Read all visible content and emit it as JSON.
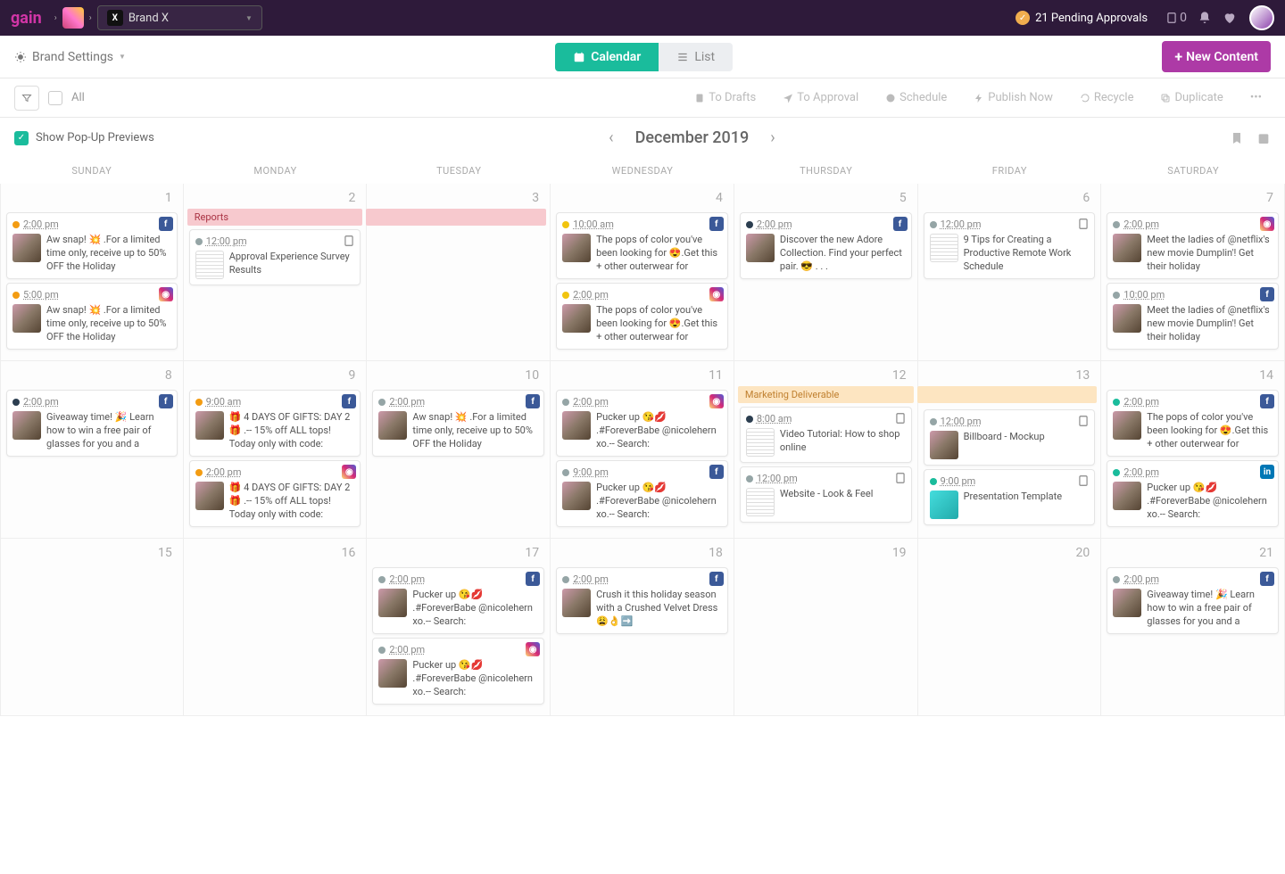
{
  "topbar": {
    "logo": "gain",
    "brand": "Brand X",
    "pending_label": "21 Pending Approvals",
    "notification_count": "0"
  },
  "secondbar": {
    "brand_settings": "Brand Settings",
    "calendar_label": "Calendar",
    "list_label": "List",
    "new_content": "New Content"
  },
  "thirdbar": {
    "all_label": "All",
    "actions": {
      "to_drafts": "To Drafts",
      "to_approval": "To Approval",
      "schedule": "Schedule",
      "publish_now": "Publish Now",
      "recycle": "Recycle",
      "duplicate": "Duplicate"
    }
  },
  "cal_header": {
    "popup_label": "Show Pop-Up Previews",
    "month": "December 2019"
  },
  "days": [
    "SUNDAY",
    "MONDAY",
    "TUESDAY",
    "WEDNESDAY",
    "THURSDAY",
    "FRIDAY",
    "SATURDAY"
  ],
  "banners": {
    "reports": "Reports",
    "marketing": "Marketing Deliverable"
  },
  "cells": [
    {
      "num": "1",
      "events": [
        {
          "dot": "orange",
          "time": "2:00 pm",
          "net": "fb",
          "text": "Aw snap! 💥 .For a limited time only, receive up to 50% OFF the Holiday"
        },
        {
          "dot": "orange",
          "time": "5:00 pm",
          "net": "ig",
          "text": "Aw snap! 💥 .For a limited time only, receive up to 50% OFF the Holiday"
        }
      ]
    },
    {
      "num": "2",
      "banner": "reports",
      "banner_color": "pink",
      "events": [
        {
          "dot": "gray",
          "time": "12:00 pm",
          "net": "doc",
          "thumb": "doc",
          "text": "Approval Experience Survey Results"
        }
      ]
    },
    {
      "num": "3",
      "events": []
    },
    {
      "num": "4",
      "events": [
        {
          "dot": "yellow",
          "time": "10:00 am",
          "net": "fb",
          "text": "The pops of color you've been looking for 😍.Get this + other outerwear for"
        },
        {
          "dot": "yellow",
          "time": "2:00 pm",
          "net": "ig",
          "text": "The pops of color you've been looking for 😍.Get this + other outerwear for"
        }
      ]
    },
    {
      "num": "5",
      "events": [
        {
          "dot": "blue",
          "time": "2:00 pm",
          "net": "fb",
          "text": "Discover the new Adore Collection. Find your perfect pair. 😎 . . ."
        }
      ]
    },
    {
      "num": "6",
      "events": [
        {
          "dot": "gray",
          "time": "12:00 pm",
          "net": "doc",
          "thumb": "doc",
          "text": "9 Tips for Creating a Productive Remote Work Schedule"
        }
      ]
    },
    {
      "num": "7",
      "events": [
        {
          "dot": "gray",
          "time": "2:00 pm",
          "net": "ig",
          "text": "Meet the ladies of @netflix's new movie Dumplin'! Get their holiday"
        },
        {
          "dot": "gray",
          "time": "10:00 pm",
          "net": "fb",
          "text": "Meet the ladies of @netflix's new movie Dumplin'! Get their holiday"
        }
      ]
    },
    {
      "num": "8",
      "events": [
        {
          "dot": "blue",
          "time": "2:00 pm",
          "net": "fb",
          "text": "Giveaway time! 🎉 Learn how to win a free pair of glasses for you and a"
        }
      ]
    },
    {
      "num": "9",
      "events": [
        {
          "dot": "orange",
          "time": "9:00 am",
          "net": "fb",
          "text": "🎁 4 DAYS OF GIFTS: DAY 2 🎁 .-- 15% off ALL tops! Today only with code:"
        },
        {
          "dot": "orange",
          "time": "2:00 pm",
          "net": "ig",
          "text": "🎁 4 DAYS OF GIFTS: DAY 2 🎁 .-- 15% off ALL tops! Today only with code:"
        }
      ]
    },
    {
      "num": "10",
      "events": [
        {
          "dot": "gray",
          "time": "2:00 pm",
          "net": "fb",
          "text": "Aw snap! 💥 .For a limited time only, receive up to 50% OFF the Holiday"
        }
      ]
    },
    {
      "num": "11",
      "events": [
        {
          "dot": "gray",
          "time": "2:00 pm",
          "net": "ig",
          "text": "Pucker up 😘💋 .#ForeverBabe @nicolehern xo.-- Search:"
        },
        {
          "dot": "gray",
          "time": "9:00 pm",
          "net": "fb",
          "text": "Pucker up 😘💋 .#ForeverBabe @nicolehern xo.-- Search:"
        }
      ]
    },
    {
      "num": "12",
      "banner": "marketing",
      "banner_color": "orange",
      "events": [
        {
          "dot": "blue",
          "time": "8:00 am",
          "net": "doc",
          "thumb": "doc",
          "text": "Video Tutorial: How to shop online"
        },
        {
          "dot": "gray",
          "time": "12:00 pm",
          "net": "doc",
          "thumb": "doc",
          "text": "Website - Look & Feel"
        }
      ]
    },
    {
      "num": "13",
      "events": [
        {
          "dot": "gray",
          "time": "12:00 pm",
          "net": "doc",
          "thumb": "photo",
          "text": "Billboard - Mockup"
        },
        {
          "dot": "teal",
          "time": "9:00 pm",
          "net": "doc",
          "thumb": "teal",
          "text": "Presentation Template"
        }
      ]
    },
    {
      "num": "14",
      "events": [
        {
          "dot": "teal",
          "time": "2:00 pm",
          "net": "fb",
          "text": "The pops of color you've been looking for 😍.Get this + other outerwear for"
        },
        {
          "dot": "teal",
          "time": "2:00 pm",
          "net": "li",
          "text": "Pucker up 😘💋 .#ForeverBabe @nicolehern xo.-- Search:"
        }
      ]
    },
    {
      "num": "15",
      "events": []
    },
    {
      "num": "16",
      "events": []
    },
    {
      "num": "17",
      "events": [
        {
          "dot": "gray",
          "time": "2:00 pm",
          "net": "fb",
          "text": "Pucker up 😘💋 .#ForeverBabe @nicolehern xo.-- Search:"
        },
        {
          "dot": "gray",
          "time": "2:00 pm",
          "net": "ig",
          "text": "Pucker up 😘💋 .#ForeverBabe @nicolehern xo.-- Search:"
        }
      ]
    },
    {
      "num": "18",
      "events": [
        {
          "dot": "gray",
          "time": "2:00 pm",
          "net": "fb",
          "text": "Crush it this holiday season with a Crushed Velvet Dress 😩👌➡️"
        }
      ]
    },
    {
      "num": "19",
      "events": []
    },
    {
      "num": "20",
      "events": []
    },
    {
      "num": "21",
      "events": [
        {
          "dot": "gray",
          "time": "2:00 pm",
          "net": "fb",
          "text": "Giveaway time! 🎉 Learn how to win a free pair of glasses for you and a"
        }
      ]
    }
  ]
}
